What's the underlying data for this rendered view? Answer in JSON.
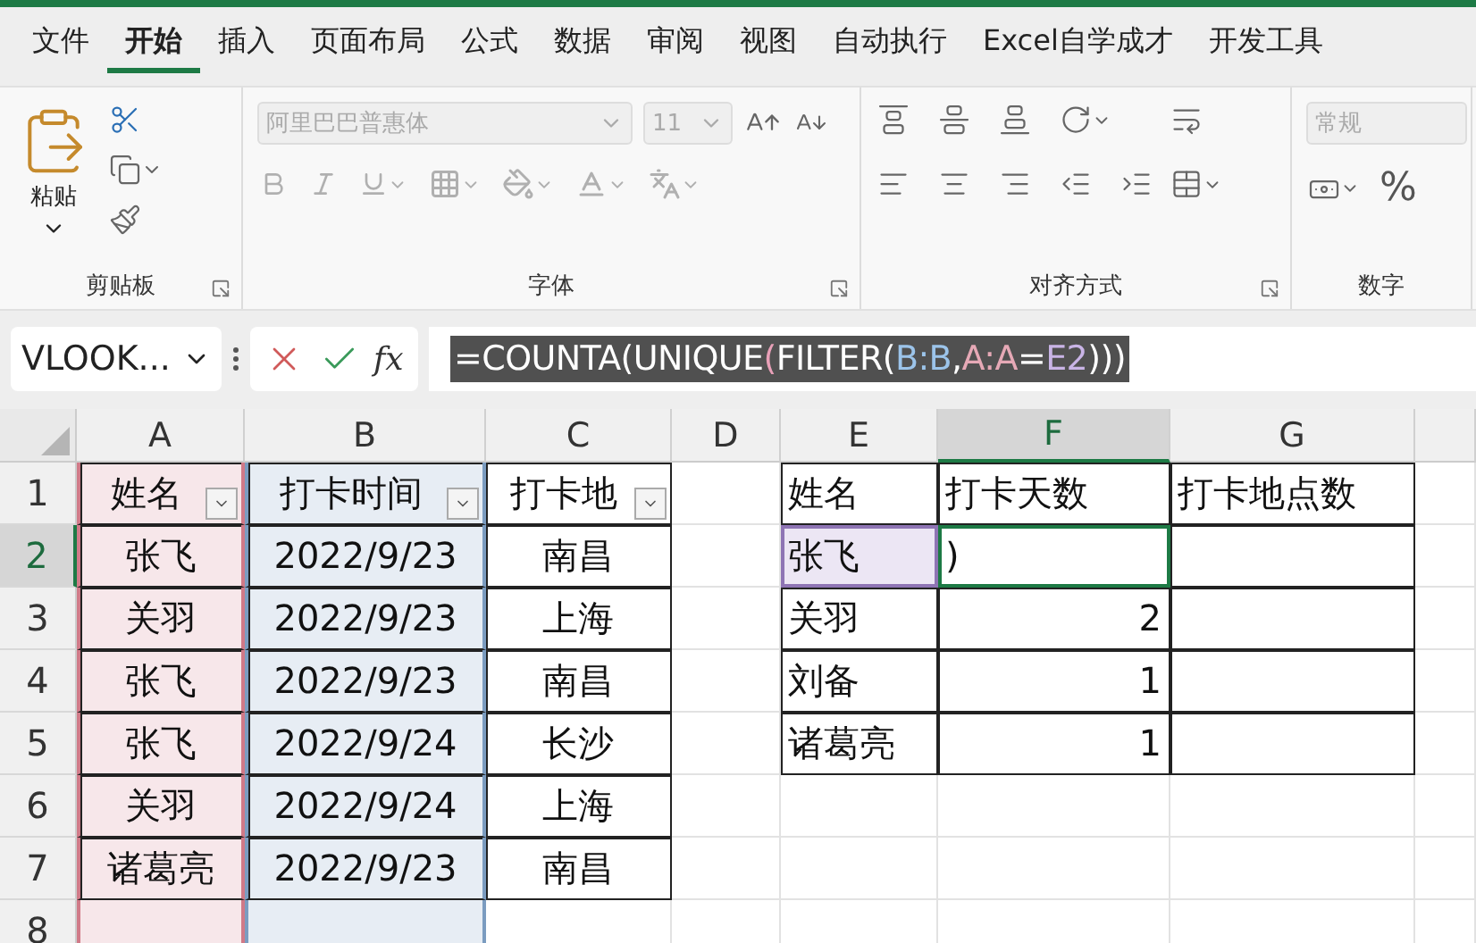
{
  "menu_tabs": [
    {
      "label": "文件",
      "selected": false
    },
    {
      "label": "开始",
      "selected": true
    },
    {
      "label": "插入",
      "selected": false
    },
    {
      "label": "页面布局",
      "selected": false
    },
    {
      "label": "公式",
      "selected": false
    },
    {
      "label": "数据",
      "selected": false
    },
    {
      "label": "审阅",
      "selected": false
    },
    {
      "label": "视图",
      "selected": false
    },
    {
      "label": "自动执行",
      "selected": false
    },
    {
      "label": "Excel自学成才",
      "selected": false
    },
    {
      "label": "开发工具",
      "selected": false
    }
  ],
  "ribbon": {
    "clipboard": {
      "paste_label": "粘贴",
      "group_label": "剪贴板"
    },
    "font": {
      "font_name": "阿里巴巴普惠体",
      "font_size": "11",
      "disabled": true,
      "group_label": "字体"
    },
    "alignment": {
      "group_label": "对齐方式"
    },
    "number": {
      "format": "常规",
      "disabled": true,
      "percent": "%",
      "group_label": "数字"
    }
  },
  "formula_bar": {
    "name_box": "VLOOK...",
    "fx": "fx",
    "formula_parts": [
      {
        "text": "=COUNTA(UNIQUE",
        "color": "#ffffff"
      },
      {
        "text": "(",
        "color": "#e8a0b8"
      },
      {
        "text": "FILTER(",
        "color": "#ffffff"
      },
      {
        "text": "B:B",
        "color": "#9cc4ea"
      },
      {
        "text": ",",
        "color": "#ffffff"
      },
      {
        "text": "A:A",
        "color": "#e6a9b6"
      },
      {
        "text": "=",
        "color": "#ffffff"
      },
      {
        "text": "E2",
        "color": "#c9b4e6"
      },
      {
        "text": ")))",
        "color": "#ffffff"
      }
    ]
  },
  "sheet": {
    "columns": [
      {
        "label": "A",
        "selected": false,
        "color": "#d07a88"
      },
      {
        "label": "B",
        "selected": false,
        "color": "#7b9cc0"
      },
      {
        "label": "C",
        "selected": false
      },
      {
        "label": "D",
        "selected": false
      },
      {
        "label": "E",
        "selected": false
      },
      {
        "label": "F",
        "selected": true
      },
      {
        "label": "G",
        "selected": false
      },
      {
        "selected": false
      }
    ],
    "rows": [
      {
        "number": "1",
        "selected": false,
        "cells": [
          {
            "text": "姓名",
            "boxed": true,
            "filter": true
          },
          {
            "text": "打卡时间",
            "boxed": true,
            "filter": true
          },
          {
            "text": "打卡地",
            "boxed": true,
            "filter": true
          },
          {},
          {
            "text": "姓名",
            "boxed": true
          },
          {
            "text": "打卡天数",
            "boxed": true
          },
          {
            "text": "打卡地点数",
            "boxed": true
          },
          {}
        ]
      },
      {
        "number": "2",
        "selected": true,
        "cells": [
          {
            "text": "张飞",
            "boxed": true
          },
          {
            "text": "2022/9/23",
            "boxed": true
          },
          {
            "text": "南昌",
            "boxed": true
          },
          {},
          {
            "text": "张飞",
            "boxed": true,
            "referenced": true
          },
          {
            "text": ")",
            "boxed": true,
            "active": true
          },
          {
            "boxed": true
          },
          {}
        ]
      },
      {
        "number": "3",
        "selected": false,
        "cells": [
          {
            "text": "关羽",
            "boxed": true
          },
          {
            "text": "2022/9/23",
            "boxed": true
          },
          {
            "text": "上海",
            "boxed": true
          },
          {},
          {
            "text": "关羽",
            "boxed": true
          },
          {
            "text": "2",
            "boxed": true,
            "numeric": true
          },
          {
            "boxed": true
          },
          {}
        ]
      },
      {
        "number": "4",
        "selected": false,
        "cells": [
          {
            "text": "张飞",
            "boxed": true
          },
          {
            "text": "2022/9/23",
            "boxed": true
          },
          {
            "text": "南昌",
            "boxed": true
          },
          {},
          {
            "text": "刘备",
            "boxed": true
          },
          {
            "text": "1",
            "boxed": true,
            "numeric": true
          },
          {
            "boxed": true
          },
          {}
        ]
      },
      {
        "number": "5",
        "selected": false,
        "cells": [
          {
            "text": "张飞",
            "boxed": true
          },
          {
            "text": "2022/9/24",
            "boxed": true
          },
          {
            "text": "长沙",
            "boxed": true
          },
          {},
          {
            "text": "诸葛亮",
            "boxed": true
          },
          {
            "text": "1",
            "boxed": true,
            "numeric": true
          },
          {
            "boxed": true
          },
          {}
        ]
      },
      {
        "number": "6",
        "selected": false,
        "cells": [
          {
            "text": "关羽",
            "boxed": true
          },
          {
            "text": "2022/9/24",
            "boxed": true
          },
          {
            "text": "上海",
            "boxed": true
          },
          {},
          {},
          {},
          {},
          {}
        ]
      },
      {
        "number": "7",
        "selected": false,
        "cells": [
          {
            "text": "诸葛亮",
            "boxed": true
          },
          {
            "text": "2022/9/23",
            "boxed": true
          },
          {
            "text": "南昌",
            "boxed": true
          },
          {},
          {},
          {},
          {},
          {}
        ]
      },
      {
        "number": "8",
        "selected": false,
        "cells": [
          {},
          {},
          {},
          {},
          {},
          {},
          {},
          {}
        ]
      }
    ]
  }
}
